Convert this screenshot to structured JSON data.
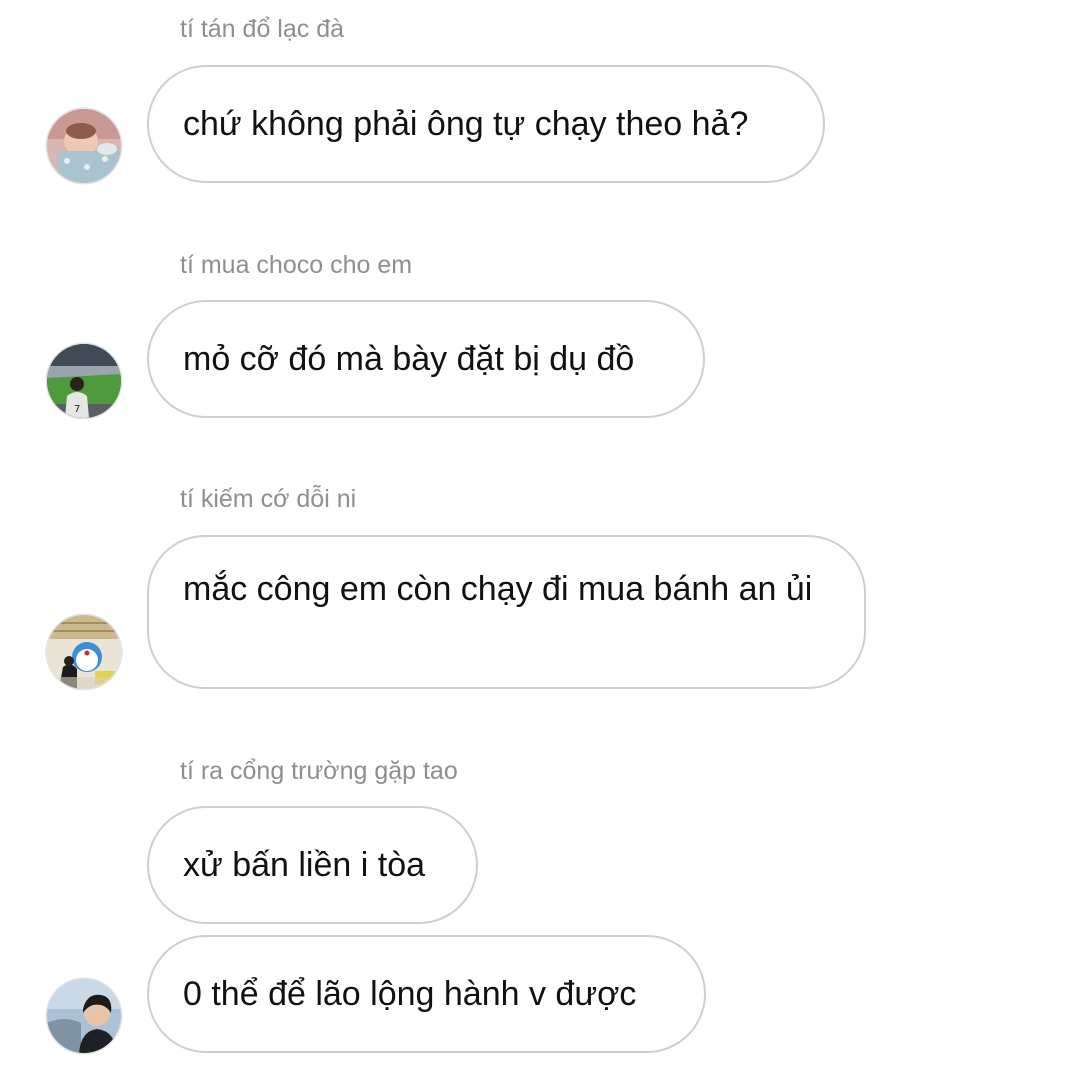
{
  "messages": [
    {
      "sender": "tí tán đổ lạc đà",
      "text": "chứ không phải ông tự chạy theo hả?"
    },
    {
      "sender": "tí mua choco cho em",
      "text": "mỏ cỡ đó mà bày đặt bị dụ đồ"
    },
    {
      "sender": "tí kiếm cớ dỗi ni",
      "text": "mắc công em còn chạy đi mua bánh an ủi"
    },
    {
      "sender": "tí ra cổng trường gặp tao",
      "text": "xử bấn liền i tòa"
    },
    {
      "sender": "",
      "text": "0 thể để lão lộng hành v được"
    }
  ],
  "avatars": [
    {
      "icon": "sleeping-baby-avatar-icon"
    },
    {
      "icon": "stadium-fan-avatar-icon"
    },
    {
      "icon": "doraemon-photo-avatar-icon"
    },
    {
      "icon": "boy-portrait-avatar-icon"
    }
  ],
  "colors": {
    "bubble_border": "#cfcfd2",
    "sender_text": "#8e8e93",
    "message_text": "#111111",
    "background": "#ffffff"
  }
}
